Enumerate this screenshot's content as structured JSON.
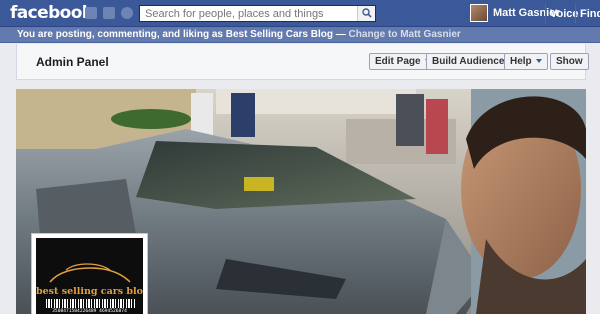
{
  "header": {
    "logo": "facebook",
    "jewels": [
      "friend-requests-icon",
      "messages-icon",
      "notifications-globe-icon"
    ],
    "search": {
      "placeholder": "Search for people, places and things",
      "icon": "magnifier-icon"
    },
    "profile_name": "Matt Gasnier",
    "nav": {
      "voice": "Voice",
      "find": "Find"
    }
  },
  "posting_bar": {
    "text": "You are posting, commenting, and liking as Best Selling Cars Blog —",
    "link": "Change to Matt Gasnier"
  },
  "admin_panel": {
    "title": "Admin Panel",
    "buttons": {
      "edit_page": "Edit Page",
      "build_audience": "Build Audience",
      "help": "Help",
      "show": "Show"
    }
  },
  "cover_photo": {
    "subject": "silver-sports-car-and-man-photo"
  },
  "profile_picture": {
    "brand_text": "best selling cars blog",
    "barcode_number": "3508471584226489 4694526874"
  },
  "colors": {
    "brand_blue": "#3b5998",
    "posting_bar": "#627aad",
    "logo_gold": "#e1a040"
  }
}
